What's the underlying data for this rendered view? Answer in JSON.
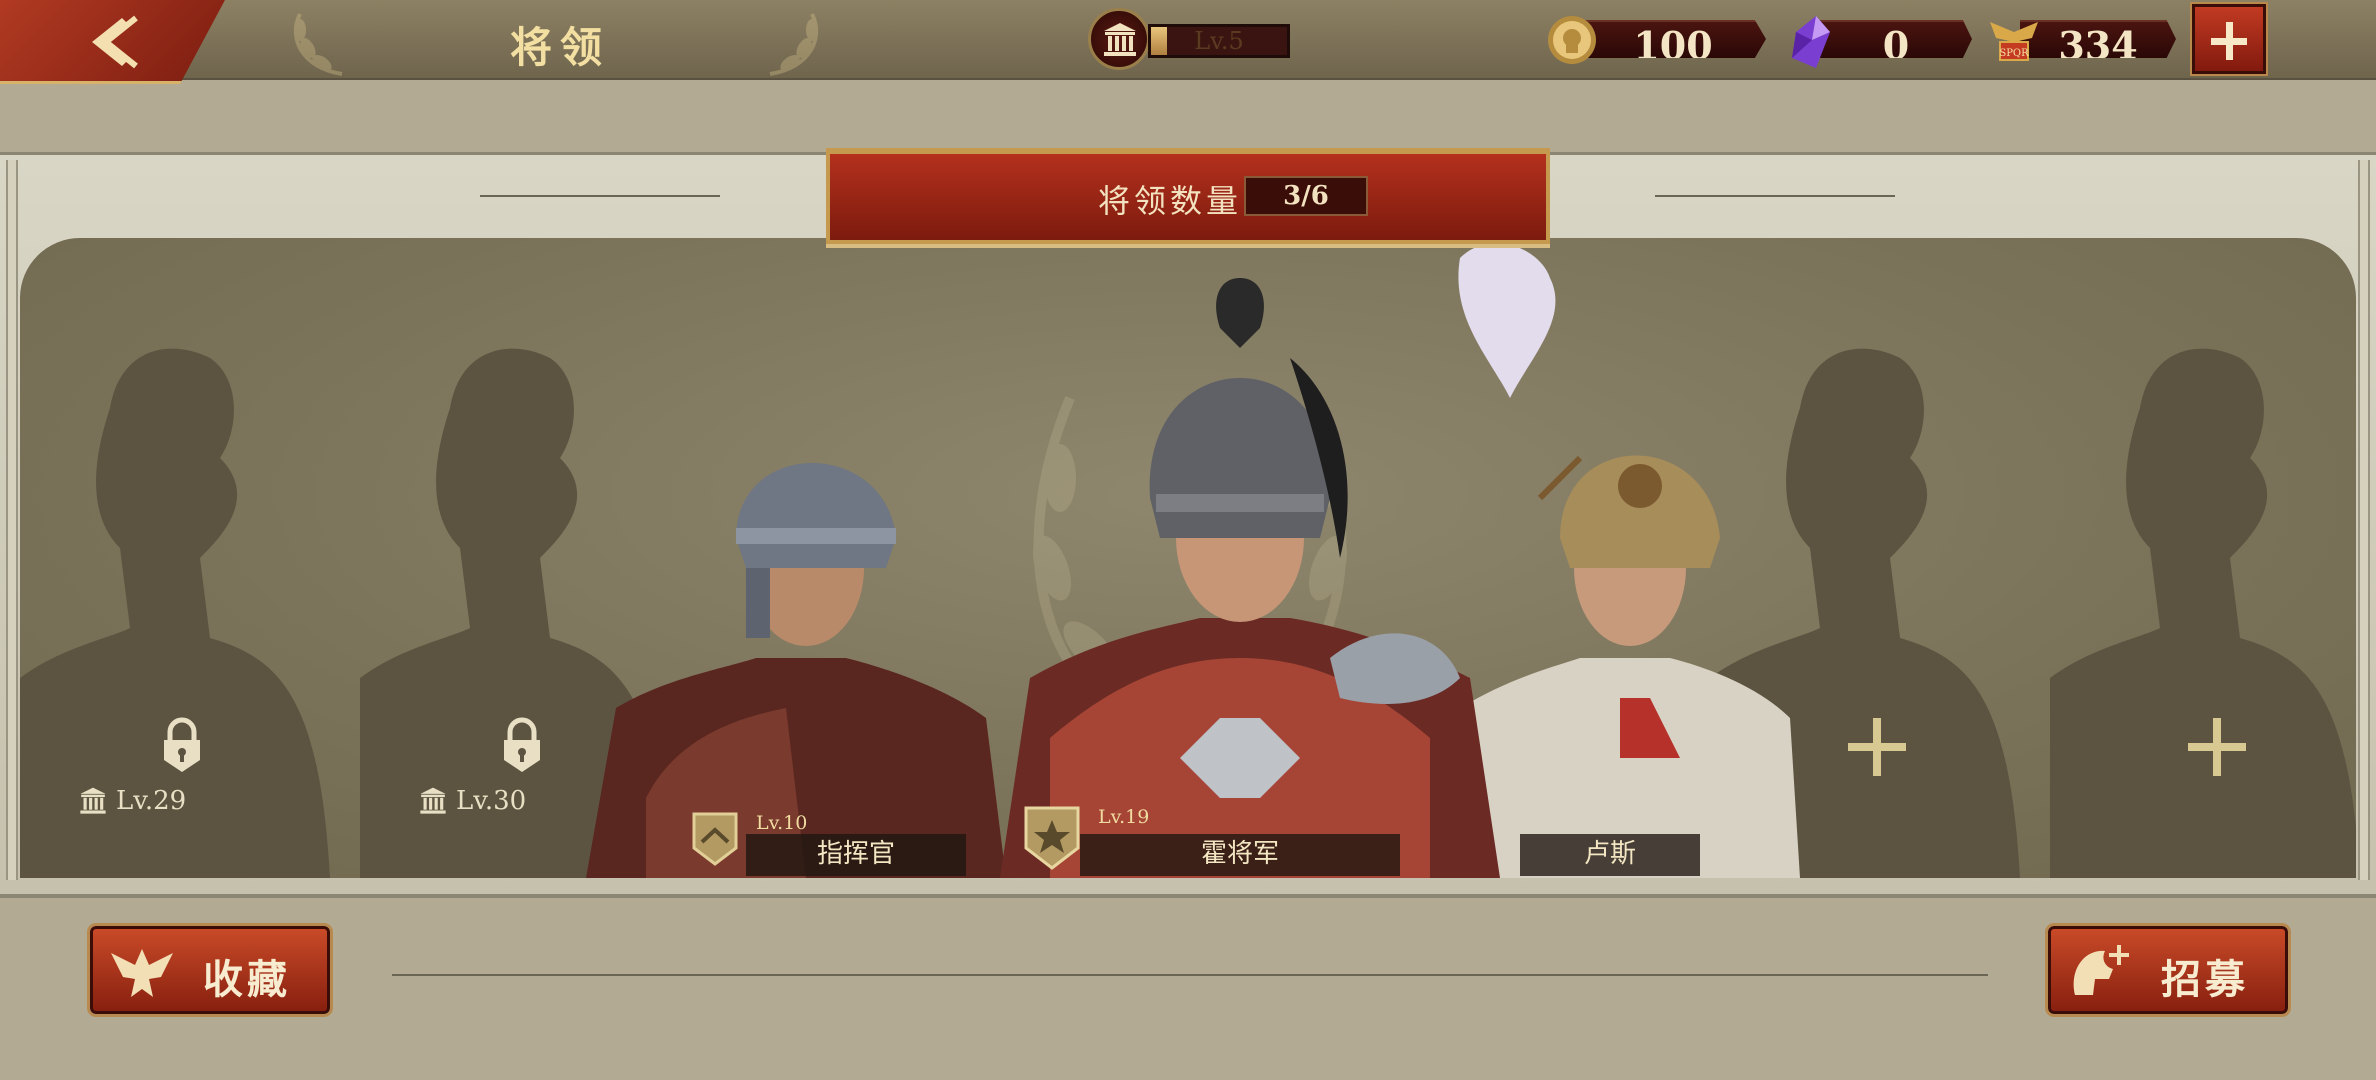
{
  "header": {
    "title": "将领",
    "player_level": "Lv.5",
    "player_level_progress": 0.12
  },
  "resources": [
    {
      "name": "gold-coin",
      "value": "100"
    },
    {
      "name": "purple-gem",
      "value": "0"
    },
    {
      "name": "spqr-token",
      "value": "334"
    }
  ],
  "count_banner": {
    "label": "将领数量",
    "value": "3/6"
  },
  "locked_slots": [
    {
      "unlock_level": "Lv.29"
    },
    {
      "unlock_level": "Lv.30"
    }
  ],
  "heroes": [
    {
      "name": "指挥官",
      "level": "Lv.10"
    },
    {
      "name": "霍将军",
      "level": "Lv.19"
    },
    {
      "name": "卢斯",
      "level": ""
    }
  ],
  "buttons": {
    "collection": "收藏",
    "recruit": "招募"
  },
  "colors": {
    "accent_red": "#b13a22",
    "gold": "#d9b26a",
    "panel_bg": "#7b7359"
  }
}
